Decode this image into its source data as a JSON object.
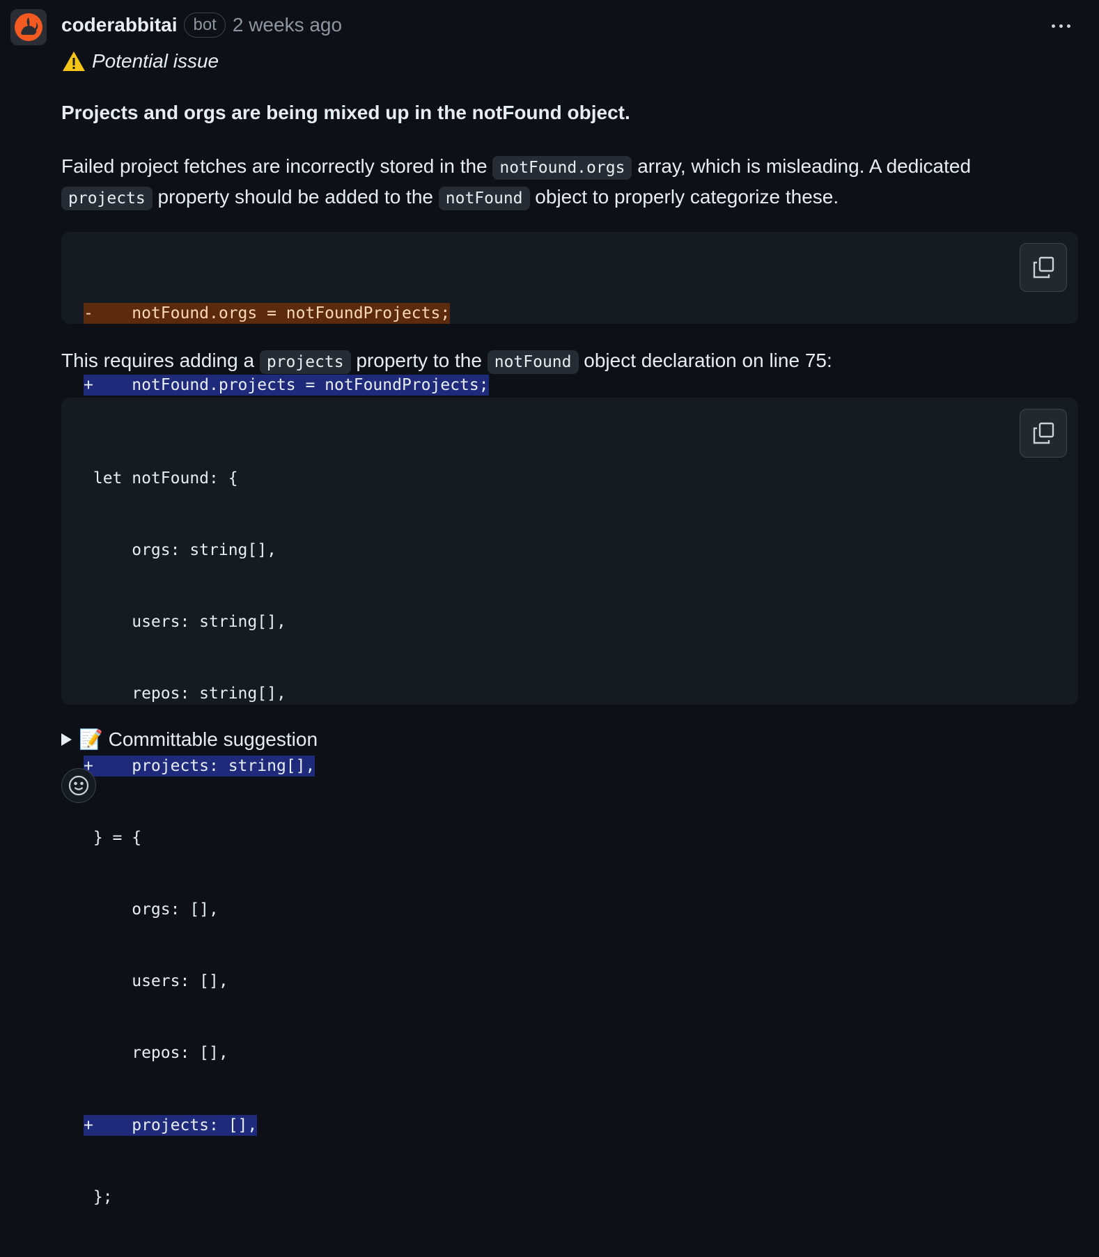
{
  "comment": {
    "author": "coderabbitai",
    "badge": "bot",
    "time": "2 weeks ago",
    "issue_label": "Potential issue",
    "headline": "Projects and orgs are being mixed up in the notFound object.",
    "p1": {
      "t1": "Failed project fetches are incorrectly stored in the ",
      "c1": "notFound.orgs",
      "t2": " array, which is misleading. A dedicated ",
      "c2": "projects",
      "t3": " property should be added to the ",
      "c3": "notFound",
      "t4": " object to properly categorize these."
    },
    "diff1": {
      "del": "-    notFound.orgs = notFoundProjects;",
      "add": "+    notFound.projects = notFoundProjects;"
    },
    "p2": {
      "t1": "This requires adding a ",
      "c1": "projects",
      "t2": " property to the ",
      "c2": "notFound",
      "t3": " object declaration on line 75:"
    },
    "diff2": {
      "l1": " let notFound: {",
      "l2": "     orgs: string[],",
      "l3": "     users: string[],",
      "l4": "     repos: string[],",
      "l5": "+    projects: string[],",
      "l6": " } = {",
      "l7": "     orgs: [],",
      "l8": "     users: [],",
      "l9": "     repos: [],",
      "l10": "+    projects: [],",
      "l11": " };"
    },
    "summary": "📝 Committable suggestion"
  },
  "icons": {
    "avatar": "rabbit-logo-icon",
    "more": "kebab-menu-icon",
    "warning": "warning-icon",
    "copy": "copy-icon",
    "emoji": "smiley-icon"
  },
  "colors": {
    "background": "#0d1117",
    "code_bg": "#151b23",
    "deleted_line": "#5c2a0c",
    "added_line": "#1f2a7a",
    "avatar_orange": "#f25a22"
  }
}
